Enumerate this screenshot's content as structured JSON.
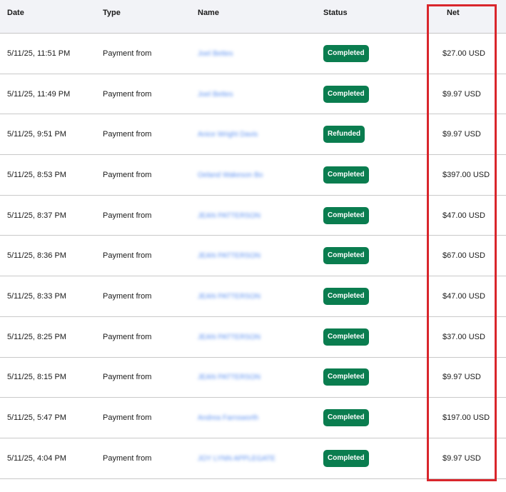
{
  "columns": {
    "date": "Date",
    "type": "Type",
    "name": "Name",
    "status": "Status",
    "net": "Net"
  },
  "rows": [
    {
      "date": "5/11/25, 11:51 PM",
      "type": "Payment from",
      "name": "Joel Bettes",
      "status": "Completed",
      "net": "$27.00 USD"
    },
    {
      "date": "5/11/25, 11:49 PM",
      "type": "Payment from",
      "name": "Joel Bettes",
      "status": "Completed",
      "net": "$9.97 USD"
    },
    {
      "date": "5/11/25, 9:51 PM",
      "type": "Payment from",
      "name": "Anice Wright Davis",
      "status": "Refunded",
      "net": "$9.97 USD"
    },
    {
      "date": "5/11/25, 8:53 PM",
      "type": "Payment from",
      "name": "Oeland Wakeson Bo",
      "status": "Completed",
      "net": "$397.00 USD"
    },
    {
      "date": "5/11/25, 8:37 PM",
      "type": "Payment from",
      "name": "JEAN PATTERSON",
      "status": "Completed",
      "net": "$47.00 USD"
    },
    {
      "date": "5/11/25, 8:36 PM",
      "type": "Payment from",
      "name": "JEAN PATTERSON",
      "status": "Completed",
      "net": "$67.00 USD"
    },
    {
      "date": "5/11/25, 8:33 PM",
      "type": "Payment from",
      "name": "JEAN PATTERSON",
      "status": "Completed",
      "net": "$47.00 USD"
    },
    {
      "date": "5/11/25, 8:25 PM",
      "type": "Payment from",
      "name": "JEAN PATTERSON",
      "status": "Completed",
      "net": "$37.00 USD"
    },
    {
      "date": "5/11/25, 8:15 PM",
      "type": "Payment from",
      "name": "JEAN PATTERSON",
      "status": "Completed",
      "net": "$9.97 USD"
    },
    {
      "date": "5/11/25, 5:47 PM",
      "type": "Payment from",
      "name": "Andrea Farnsworth",
      "status": "Completed",
      "net": "$197.00 USD"
    },
    {
      "date": "5/11/25, 4:04 PM",
      "type": "Payment from",
      "name": "JOY LYNN APPLEGATE",
      "status": "Completed",
      "net": "$9.97 USD"
    }
  ],
  "colors": {
    "status_badge": "#0a7d4f",
    "highlight": "#d9262c",
    "header_bg": "#f2f3f7",
    "name_link": "#5a8ff0"
  }
}
